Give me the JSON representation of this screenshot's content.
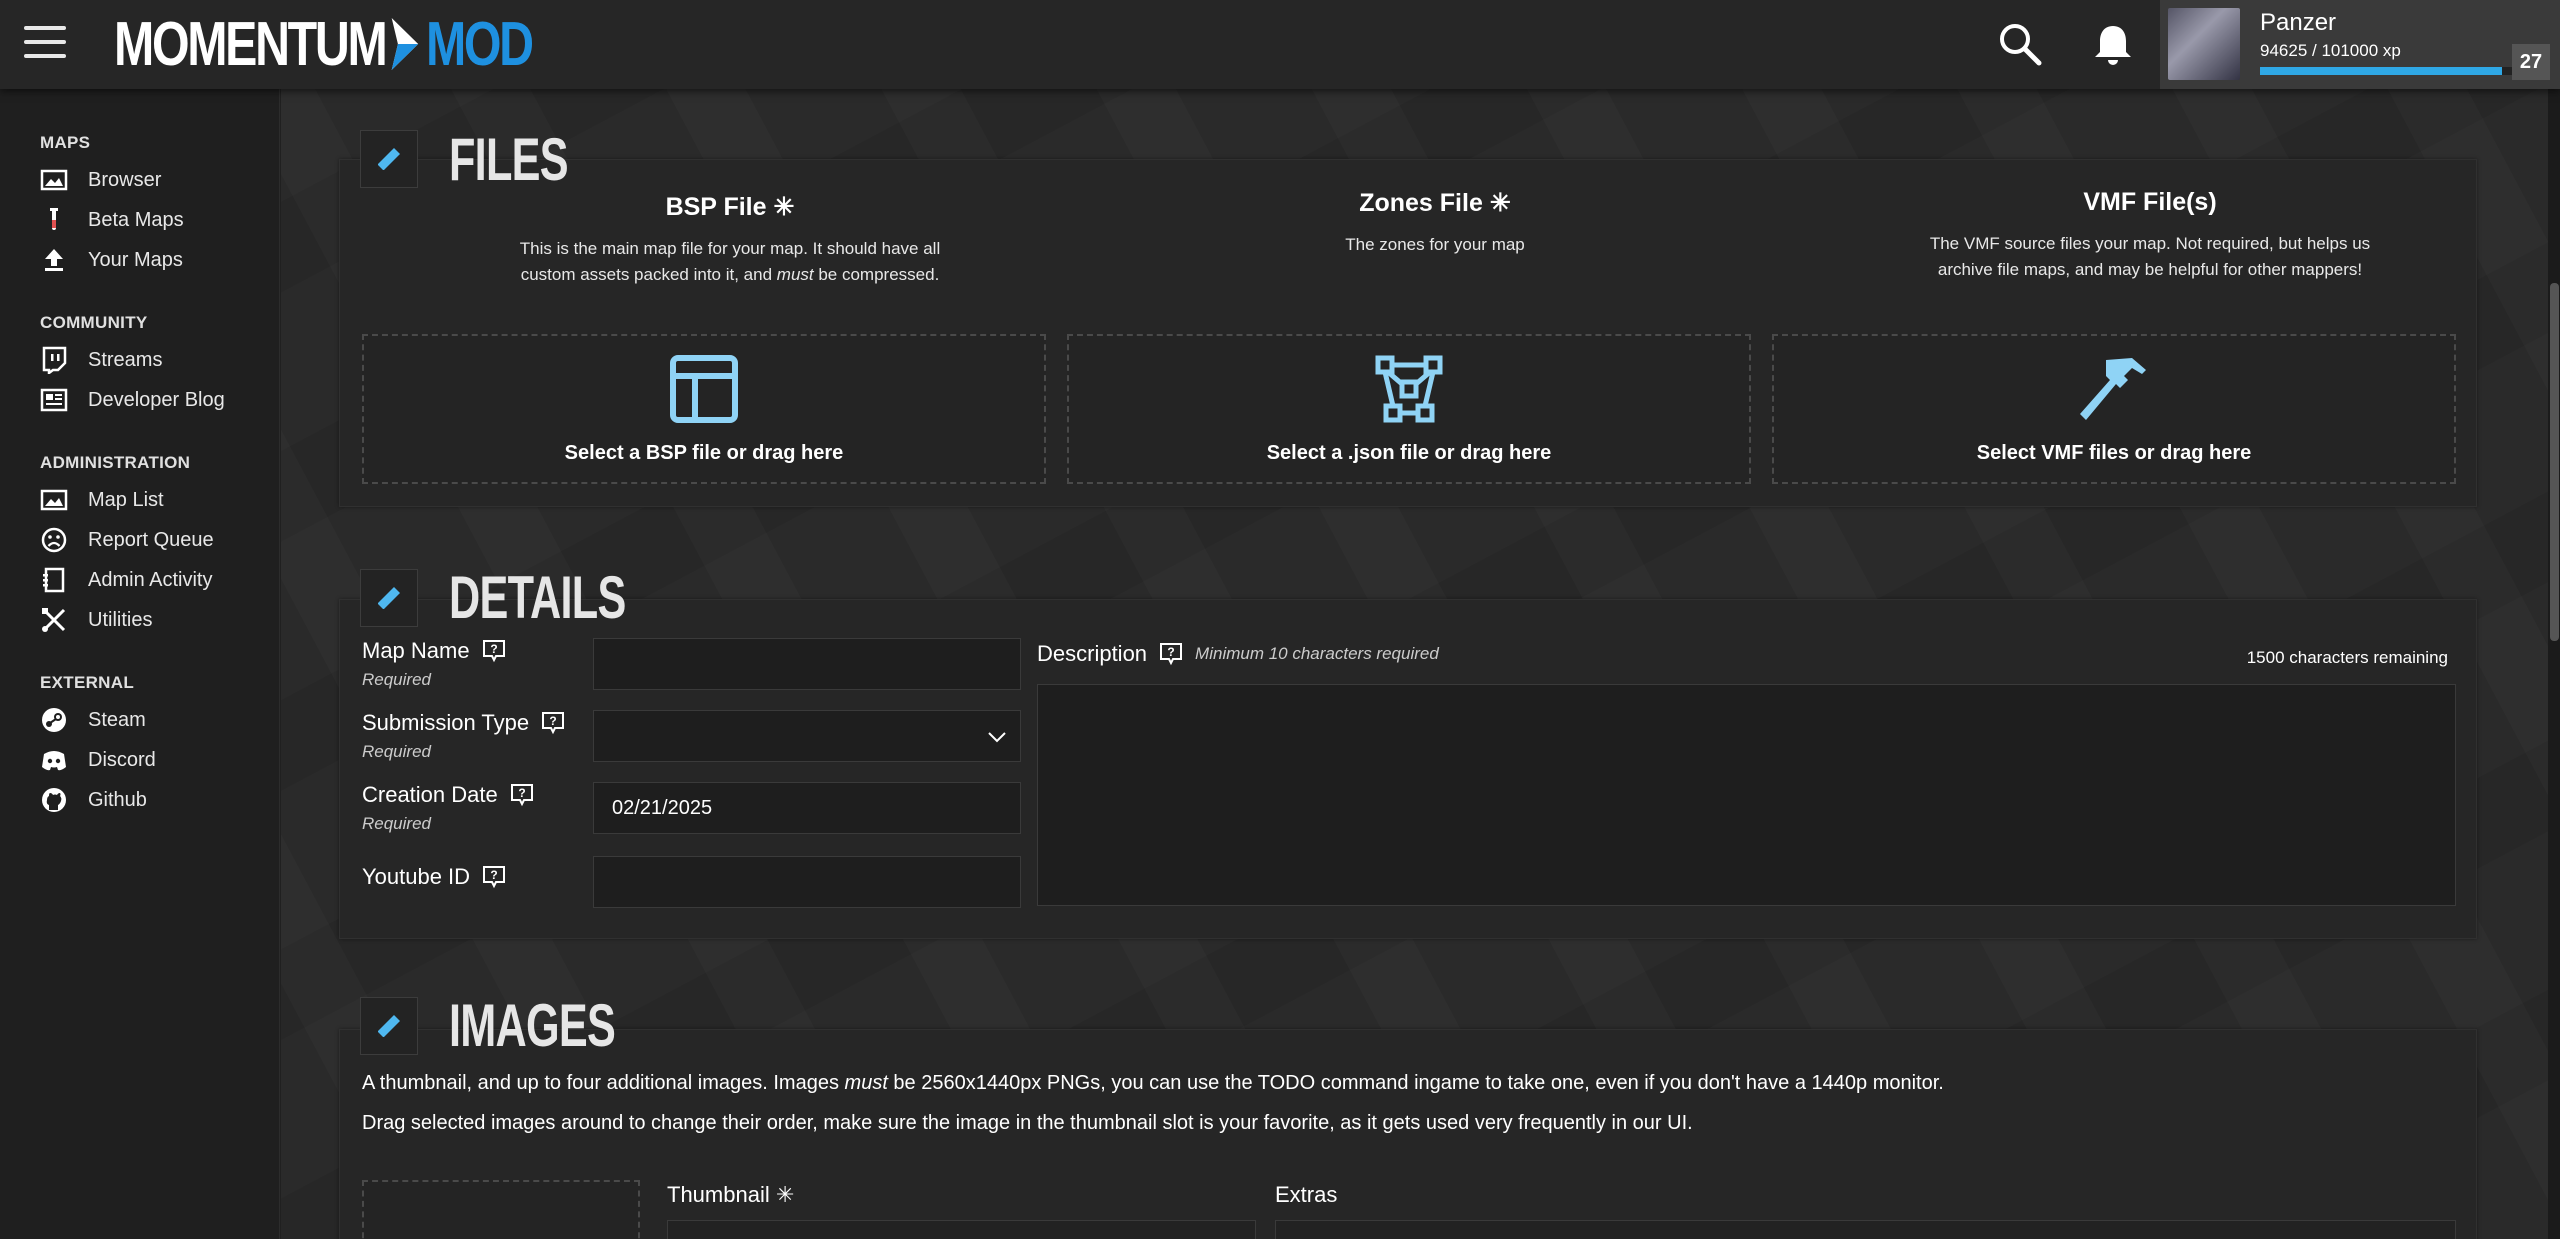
{
  "header": {
    "logo_left": "MOMENTUM",
    "logo_right": "MOD",
    "user": {
      "name": "Panzer",
      "xp_text": "94625 / 101000 xp",
      "xp_fraction": 0.937,
      "level": "27"
    },
    "icons": [
      "menu-icon",
      "search-icon",
      "bell-icon"
    ]
  },
  "sidebar": {
    "sections": [
      {
        "title": "MAPS",
        "items": [
          {
            "label": "Browser",
            "icon": "image-icon"
          },
          {
            "label": "Beta Maps",
            "icon": "flask-icon"
          },
          {
            "label": "Your Maps",
            "icon": "upload-icon"
          }
        ]
      },
      {
        "title": "COMMUNITY",
        "items": [
          {
            "label": "Streams",
            "icon": "twitch-icon"
          },
          {
            "label": "Developer Blog",
            "icon": "newspaper-icon"
          }
        ]
      },
      {
        "title": "ADMINISTRATION",
        "items": [
          {
            "label": "Map List",
            "icon": "image-icon"
          },
          {
            "label": "Report Queue",
            "icon": "sad-face-icon"
          },
          {
            "label": "Admin Activity",
            "icon": "clipboard-icon"
          },
          {
            "label": "Utilities",
            "icon": "tools-icon"
          }
        ]
      },
      {
        "title": "EXTERNAL",
        "items": [
          {
            "label": "Steam",
            "icon": "steam-icon"
          },
          {
            "label": "Discord",
            "icon": "discord-icon"
          },
          {
            "label": "Github",
            "icon": "github-icon"
          }
        ]
      }
    ]
  },
  "files": {
    "title": "FILES",
    "bsp": {
      "title": "BSP File",
      "desc_1": "This is the main map file for your map. It should have all",
      "desc_2a": "custom assets packed into it, and ",
      "desc_2b": "must",
      "desc_2c": " be compressed.",
      "drop": "Select a BSP file or drag here"
    },
    "zones": {
      "title": "Zones File",
      "desc": "The zones for your map",
      "drop": "Select a .json file or drag here"
    },
    "vmf": {
      "title": "VMF File(s)",
      "desc_1": "The VMF source files your map. Not required, but helps us",
      "desc_2": "archive file maps, and may be helpful for other mappers!",
      "drop": "Select VMF files or drag here"
    },
    "required_mark": "✳"
  },
  "details": {
    "title": "DETAILS",
    "map_name": {
      "label": "Map Name",
      "req": "Required",
      "value": ""
    },
    "submission_type": {
      "label": "Submission Type",
      "req": "Required",
      "value": ""
    },
    "creation_date": {
      "label": "Creation Date",
      "req": "Required",
      "value": "02/21/2025"
    },
    "youtube_id": {
      "label": "Youtube ID",
      "value": ""
    },
    "description": {
      "label": "Description",
      "hint": "Minimum 10 characters required",
      "remaining": "1500 characters remaining",
      "value": ""
    }
  },
  "images": {
    "title": "IMAGES",
    "line1a": "A thumbnail, and up to four additional images. Images ",
    "line1b": "must",
    "line1c": " be 2560x1440px PNGs, you can use the TODO command ingame to take one, even if you don't have a 1440p monitor.",
    "line2": "Drag selected images around to change their order, make sure the image in the thumbnail slot is your favorite, as it gets used very frequently in our UI.",
    "thumbnail_label": "Thumbnail",
    "extras_label": "Extras"
  }
}
